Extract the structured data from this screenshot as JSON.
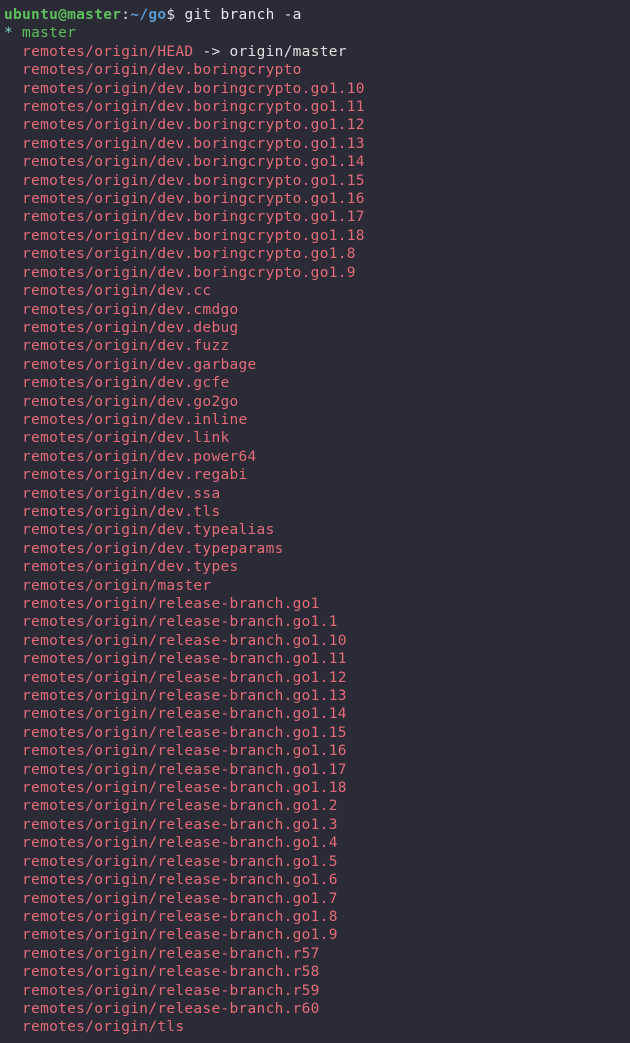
{
  "prompt": {
    "user_host": "ubuntu@master",
    "colon": ":",
    "path": "~/go",
    "dollar": "$ ",
    "command": "git branch -a"
  },
  "current": {
    "star": "* ",
    "name": "master"
  },
  "head": {
    "indent": "  ",
    "remote": "remotes/origin/HEAD",
    "arrow": " -> ",
    "target": "origin/master"
  },
  "remotes_indent": "  ",
  "remotes": [
    "remotes/origin/dev.boringcrypto",
    "remotes/origin/dev.boringcrypto.go1.10",
    "remotes/origin/dev.boringcrypto.go1.11",
    "remotes/origin/dev.boringcrypto.go1.12",
    "remotes/origin/dev.boringcrypto.go1.13",
    "remotes/origin/dev.boringcrypto.go1.14",
    "remotes/origin/dev.boringcrypto.go1.15",
    "remotes/origin/dev.boringcrypto.go1.16",
    "remotes/origin/dev.boringcrypto.go1.17",
    "remotes/origin/dev.boringcrypto.go1.18",
    "remotes/origin/dev.boringcrypto.go1.8",
    "remotes/origin/dev.boringcrypto.go1.9",
    "remotes/origin/dev.cc",
    "remotes/origin/dev.cmdgo",
    "remotes/origin/dev.debug",
    "remotes/origin/dev.fuzz",
    "remotes/origin/dev.garbage",
    "remotes/origin/dev.gcfe",
    "remotes/origin/dev.go2go",
    "remotes/origin/dev.inline",
    "remotes/origin/dev.link",
    "remotes/origin/dev.power64",
    "remotes/origin/dev.regabi",
    "remotes/origin/dev.ssa",
    "remotes/origin/dev.tls",
    "remotes/origin/dev.typealias",
    "remotes/origin/dev.typeparams",
    "remotes/origin/dev.types",
    "remotes/origin/master",
    "remotes/origin/release-branch.go1",
    "remotes/origin/release-branch.go1.1",
    "remotes/origin/release-branch.go1.10",
    "remotes/origin/release-branch.go1.11",
    "remotes/origin/release-branch.go1.12",
    "remotes/origin/release-branch.go1.13",
    "remotes/origin/release-branch.go1.14",
    "remotes/origin/release-branch.go1.15",
    "remotes/origin/release-branch.go1.16",
    "remotes/origin/release-branch.go1.17",
    "remotes/origin/release-branch.go1.18",
    "remotes/origin/release-branch.go1.2",
    "remotes/origin/release-branch.go1.3",
    "remotes/origin/release-branch.go1.4",
    "remotes/origin/release-branch.go1.5",
    "remotes/origin/release-branch.go1.6",
    "remotes/origin/release-branch.go1.7",
    "remotes/origin/release-branch.go1.8",
    "remotes/origin/release-branch.go1.9",
    "remotes/origin/release-branch.r57",
    "remotes/origin/release-branch.r58",
    "remotes/origin/release-branch.r59",
    "remotes/origin/release-branch.r60",
    "remotes/origin/tls"
  ]
}
